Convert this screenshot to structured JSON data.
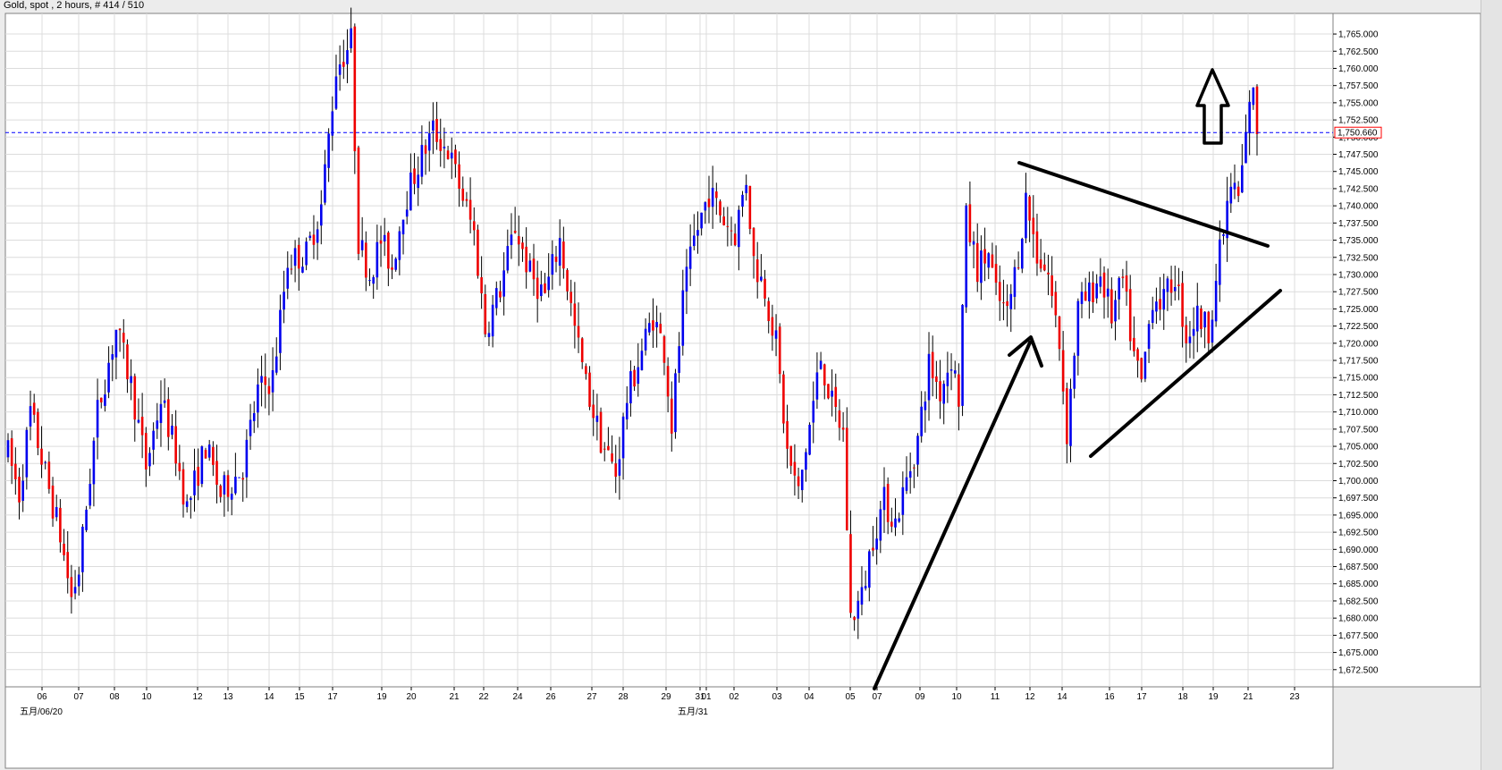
{
  "header": {
    "title": "Gold, spot , 2 hours, # 414 / 510"
  },
  "colors": {
    "up": "#0000ee",
    "down": "#ee0000",
    "wick": "#000000",
    "grid": "#dcdcdc",
    "price_line": "#0000ff",
    "price_label_border": "#ff0000",
    "annotation": "#000000"
  },
  "chart_data": {
    "type": "candlestick",
    "title": "Gold, spot , 2 hours, # 414 / 510",
    "ylim": [
      1670.0,
      1768.0
    ],
    "y_ticks": [
      "1,672.500",
      "1,675.000",
      "1,677.500",
      "1,680.000",
      "1,682.500",
      "1,685.000",
      "1,687.500",
      "1,690.000",
      "1,692.500",
      "1,695.000",
      "1,697.500",
      "1,700.000",
      "1,702.500",
      "1,705.000",
      "1,707.500",
      "1,710.000",
      "1,712.500",
      "1,715.000",
      "1,717.500",
      "1,720.000",
      "1,722.500",
      "1,725.000",
      "1,727.500",
      "1,730.000",
      "1,732.500",
      "1,735.000",
      "1,737.500",
      "1,740.000",
      "1,742.500",
      "1,745.000",
      "1,747.500",
      "1,750.000",
      "1,752.500",
      "1,755.000",
      "1,757.500",
      "1,760.000",
      "1,762.500",
      "1,765.000"
    ],
    "x_labels": [
      "06",
      "07",
      "08",
      "10",
      "12",
      "13",
      "14",
      "15",
      "17",
      "19",
      "20",
      "21",
      "22",
      "24",
      "26",
      "27",
      "28",
      "29",
      "31",
      "01",
      "02",
      "03",
      "04",
      "05",
      "07",
      "09",
      "10",
      "11",
      "12",
      "14",
      "16",
      "17",
      "18",
      "19",
      "21",
      "23"
    ],
    "x_sub_labels": [
      "五月/06/20",
      "五月/31"
    ],
    "grid": true,
    "current_price": 1750.66,
    "current_price_label": "1,750.660",
    "anchors": [
      [
        0,
        1704
      ],
      [
        3,
        1698
      ],
      [
        6,
        1710
      ],
      [
        10,
        1701
      ],
      [
        14,
        1692
      ],
      [
        17,
        1683
      ],
      [
        19,
        1687
      ],
      [
        24,
        1710
      ],
      [
        29,
        1722
      ],
      [
        33,
        1714
      ],
      [
        37,
        1702
      ],
      [
        41,
        1712
      ],
      [
        45,
        1704
      ],
      [
        48,
        1696
      ],
      [
        53,
        1705
      ],
      [
        57,
        1698
      ],
      [
        63,
        1702
      ],
      [
        67,
        1713
      ],
      [
        71,
        1715
      ],
      [
        75,
        1732
      ],
      [
        80,
        1733
      ],
      [
        84,
        1740
      ],
      [
        88,
        1760
      ],
      [
        92,
        1764
      ],
      [
        94,
        1735
      ],
      [
        97,
        1730
      ],
      [
        100,
        1735
      ],
      [
        103,
        1731
      ],
      [
        106,
        1740
      ],
      [
        110,
        1746
      ],
      [
        114,
        1751
      ],
      [
        118,
        1748
      ],
      [
        121,
        1743
      ],
      [
        125,
        1736
      ],
      [
        128,
        1722
      ],
      [
        132,
        1728
      ],
      [
        136,
        1737
      ],
      [
        140,
        1730
      ],
      [
        144,
        1727
      ],
      [
        148,
        1735
      ],
      [
        152,
        1722
      ],
      [
        155,
        1714
      ],
      [
        159,
        1706
      ],
      [
        163,
        1701
      ],
      [
        166,
        1712
      ],
      [
        170,
        1719
      ],
      [
        173,
        1724
      ],
      [
        176,
        1719
      ],
      [
        178,
        1708
      ],
      [
        181,
        1726
      ],
      [
        184,
        1735
      ],
      [
        188,
        1742
      ],
      [
        192,
        1738
      ],
      [
        195,
        1736
      ],
      [
        198,
        1744
      ],
      [
        200,
        1732
      ],
      [
        203,
        1728
      ],
      [
        206,
        1720
      ],
      [
        209,
        1704
      ],
      [
        212,
        1698
      ],
      [
        215,
        1708
      ],
      [
        218,
        1718
      ],
      [
        221,
        1711
      ],
      [
        224,
        1707
      ],
      [
        226,
        1680
      ],
      [
        229,
        1683
      ],
      [
        232,
        1692
      ],
      [
        235,
        1697
      ],
      [
        238,
        1694
      ],
      [
        241,
        1700
      ],
      [
        244,
        1706
      ],
      [
        247,
        1717
      ],
      [
        250,
        1713
      ],
      [
        253,
        1718
      ],
      [
        255,
        1712
      ],
      [
        257,
        1738
      ],
      [
        260,
        1731
      ],
      [
        263,
        1733
      ],
      [
        265,
        1727
      ],
      [
        268,
        1724
      ],
      [
        271,
        1733
      ],
      [
        273,
        1741
      ],
      [
        276,
        1733
      ],
      [
        279,
        1730
      ],
      [
        282,
        1720
      ],
      [
        284,
        1707
      ],
      [
        287,
        1725
      ],
      [
        290,
        1727
      ],
      [
        293,
        1730
      ],
      [
        296,
        1724
      ],
      [
        299,
        1729
      ],
      [
        302,
        1718
      ],
      [
        304,
        1714
      ],
      [
        307,
        1727
      ],
      [
        310,
        1726
      ],
      [
        313,
        1730
      ],
      [
        316,
        1721
      ],
      [
        319,
        1724
      ],
      [
        322,
        1722
      ],
      [
        325,
        1733
      ],
      [
        328,
        1743
      ],
      [
        330,
        1741
      ],
      [
        332,
        1750
      ],
      [
        334,
        1758
      ],
      [
        335,
        1749
      ]
    ]
  },
  "annotations": {
    "resistance_line": [
      [
        1140,
        182
      ],
      [
        1418,
        275
      ]
    ],
    "support_line": [
      [
        1220,
        510
      ],
      [
        1432,
        325
      ]
    ],
    "trend_line": [
      [
        978,
        770
      ],
      [
        1152,
        383
      ]
    ],
    "up_arrow": "up-arrow"
  }
}
